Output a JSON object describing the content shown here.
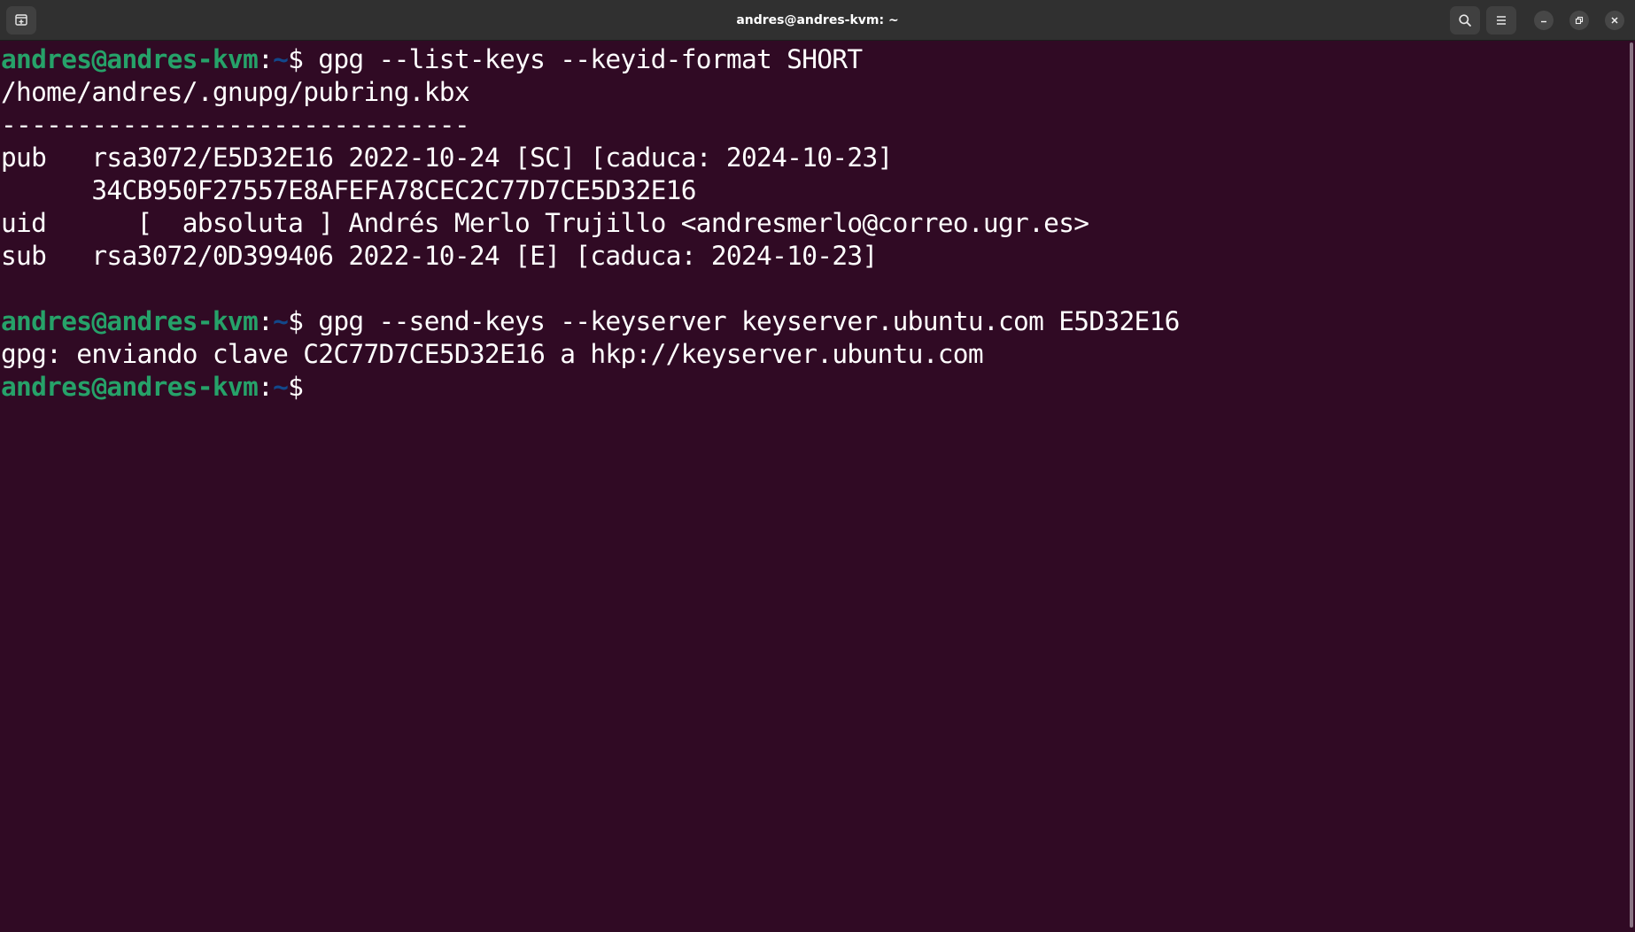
{
  "window": {
    "title": "andres@andres-kvm: ~",
    "colors": {
      "background": "#300a24",
      "prompt_user": "#26a269",
      "prompt_path": "#12488b",
      "text": "#ffffff",
      "titlebar": "#303030"
    },
    "icons": {
      "new_tab": "new-tab-icon",
      "search": "search-icon",
      "menu": "hamburger-menu-icon",
      "minimize": "minimize-icon",
      "maximize": "maximize-icon",
      "close": "close-icon"
    }
  },
  "terminal": {
    "prompt": {
      "user_host": "andres@andres-kvm",
      "colon": ":",
      "path": "~",
      "symbol": "$"
    },
    "lines": [
      {
        "type": "command",
        "text": " gpg --list-keys --keyid-format SHORT"
      },
      {
        "type": "output",
        "text": "/home/andres/.gnupg/pubring.kbx"
      },
      {
        "type": "output",
        "text": "-------------------------------"
      },
      {
        "type": "output",
        "text": "pub   rsa3072/E5D32E16 2022-10-24 [SC] [caduca: 2024-10-23]"
      },
      {
        "type": "output",
        "text": "      34CB950F27557E8AFEFA78CEC2C77D7CE5D32E16"
      },
      {
        "type": "output",
        "text": "uid      [  absoluta ] Andrés Merlo Trujillo <andresmerlo@correo.ugr.es>"
      },
      {
        "type": "output",
        "text": "sub   rsa3072/0D399406 2022-10-24 [E] [caduca: 2024-10-23]"
      },
      {
        "type": "output",
        "text": ""
      },
      {
        "type": "command",
        "text": " gpg --send-keys --keyserver keyserver.ubuntu.com E5D32E16"
      },
      {
        "type": "output",
        "text": "gpg: enviando clave C2C77D7CE5D32E16 a hkp://keyserver.ubuntu.com"
      },
      {
        "type": "command",
        "text": ""
      }
    ]
  }
}
